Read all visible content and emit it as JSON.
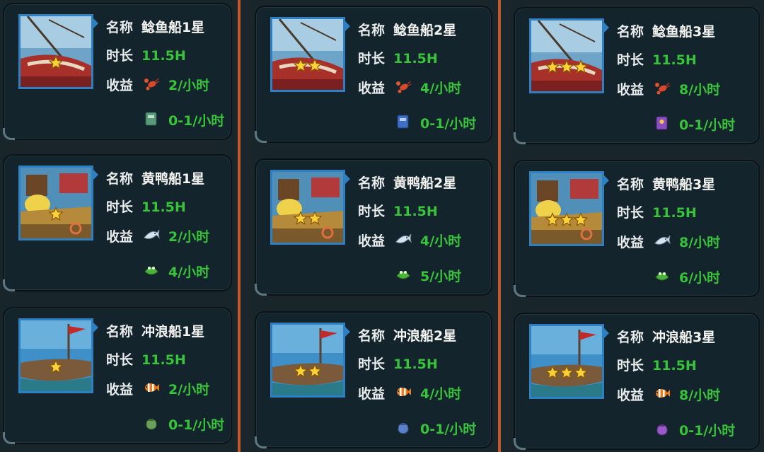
{
  "labels": {
    "name": "名称",
    "duration": "时长",
    "income": "收益"
  },
  "columns": [
    {
      "cards": [
        {
          "name": "鲶鱼船1星",
          "duration": "11.5H",
          "stars": 1,
          "theme": "catfish",
          "income1": {
            "icon": "lobster-icon",
            "value": "2/小时"
          },
          "income2": {
            "icon": "green-book-icon",
            "value": "0-1/小时"
          }
        },
        {
          "name": "黄鸭船1星",
          "duration": "11.5H",
          "stars": 1,
          "theme": "duck",
          "income1": {
            "icon": "sardine-icon",
            "value": "2/小时"
          },
          "income2": {
            "icon": "green-frog-icon",
            "value": "4/小时"
          }
        },
        {
          "name": "冲浪船1星",
          "duration": "11.5H",
          "stars": 1,
          "theme": "surf",
          "income1": {
            "icon": "clownfish-icon",
            "value": "2/小时"
          },
          "income2": {
            "icon": "green-pouch-icon",
            "value": "0-1/小时"
          }
        }
      ]
    },
    {
      "cards": [
        {
          "name": "鲶鱼船2星",
          "duration": "11.5H",
          "stars": 2,
          "theme": "catfish",
          "income1": {
            "icon": "lobster-icon",
            "value": "4/小时"
          },
          "income2": {
            "icon": "blue-book-icon",
            "value": "0-1/小时"
          }
        },
        {
          "name": "黄鸭船2星",
          "duration": "11.5H",
          "stars": 2,
          "theme": "duck",
          "income1": {
            "icon": "sardine-icon",
            "value": "4/小时"
          },
          "income2": {
            "icon": "green-frog-icon",
            "value": "5/小时"
          }
        },
        {
          "name": "冲浪船2星",
          "duration": "11.5H",
          "stars": 2,
          "theme": "surf",
          "income1": {
            "icon": "clownfish-icon",
            "value": "4/小时"
          },
          "income2": {
            "icon": "blue-pouch-icon",
            "value": "0-1/小时"
          }
        }
      ]
    },
    {
      "cards": [
        {
          "name": "鲶鱼船3星",
          "duration": "11.5H",
          "stars": 3,
          "theme": "catfish",
          "income1": {
            "icon": "lobster-icon",
            "value": "8/小时"
          },
          "income2": {
            "icon": "purple-book-icon",
            "value": "0-1/小时"
          }
        },
        {
          "name": "黄鸭船3星",
          "duration": "11.5H",
          "stars": 3,
          "theme": "duck",
          "income1": {
            "icon": "sardine-icon",
            "value": "8/小时"
          },
          "income2": {
            "icon": "green-frog-icon",
            "value": "6/小时"
          }
        },
        {
          "name": "冲浪船3星",
          "duration": "11.5H",
          "stars": 3,
          "theme": "surf",
          "income1": {
            "icon": "clownfish-icon",
            "value": "8/小时"
          },
          "income2": {
            "icon": "purple-pouch-icon",
            "value": "0-1/小时"
          }
        }
      ]
    }
  ],
  "colors": {
    "accent_divider": "#c2582a",
    "green_text": "#37c43a",
    "portrait_border": "#2f7fc3"
  }
}
